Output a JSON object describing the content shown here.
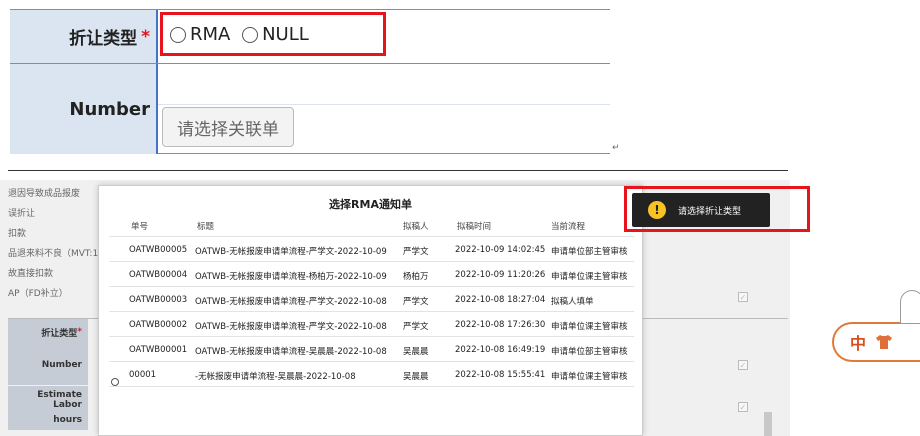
{
  "top_form": {
    "discount_type_label": "折让类型",
    "required_mark": "*",
    "radio_options": [
      "RMA",
      "NULL"
    ],
    "number_label": "Number",
    "select_button": "请选择关联单",
    "return_mark": "↵"
  },
  "background_page": {
    "left_items": [
      "退因导致成品报废",
      "误折让",
      "扣款",
      "品退来料不良（MVT:1",
      "故直接扣款",
      "AP（FD补立）"
    ],
    "field_discount_type": "折让类型",
    "required_mark": "*",
    "field_number": "Number",
    "field_estimate_labor": "Estimate Labor",
    "field_hours": "hours"
  },
  "modal": {
    "title": "选择RMA通知单",
    "columns": [
      "单号",
      "标题",
      "拟稿人",
      "拟稿时间",
      "当前流程"
    ],
    "rows": [
      {
        "no": "OATWB00005",
        "title": "OATWB-无帐报废申请单流程-严学文-2022-10-09",
        "author": "严学文",
        "time": "2022-10-09 14:02:45",
        "flow": "申请单位部主管审核"
      },
      {
        "no": "OATWB00004",
        "title": "OATWB-无帐报废申请单流程-杨柏万-2022-10-09",
        "author": "杨柏万",
        "time": "2022-10-09 11:20:26",
        "flow": "申请单位课主管审核"
      },
      {
        "no": "OATWB00003",
        "title": "OATWB-无帐报废申请单流程-严学文-2022-10-08",
        "author": "严学文",
        "time": "2022-10-08 18:27:04",
        "flow": "拟稿人填单"
      },
      {
        "no": "OATWB00002",
        "title": "OATWB-无帐报废申请单流程-严学文-2022-10-08",
        "author": "严学文",
        "time": "2022-10-08 17:26:30",
        "flow": "申请单位课主管审核"
      },
      {
        "no": "OATWB00001",
        "title": "OATWB-无帐报废申请单流程-吴晨晨-2022-10-08",
        "author": "吴晨晨",
        "time": "2022-10-08 16:49:19",
        "flow": "申请单位部主管审核"
      },
      {
        "no": "00001",
        "title": "-无帐报废申请单流程-吴晨晨-2022-10-08",
        "author": "吴晨晨",
        "time": "2022-10-08 15:55:41",
        "flow": "申请单位课主管审核"
      }
    ]
  },
  "toast": {
    "icon": "!",
    "message": "请选择折让类型"
  },
  "ime_badge": {
    "label": "中"
  },
  "colors": {
    "label_bg": "#dbe5f1",
    "border_blue": "#4472c4",
    "highlight_red": "#e8141b",
    "toast_bg": "#222222",
    "warning_yellow": "#f7c223"
  }
}
